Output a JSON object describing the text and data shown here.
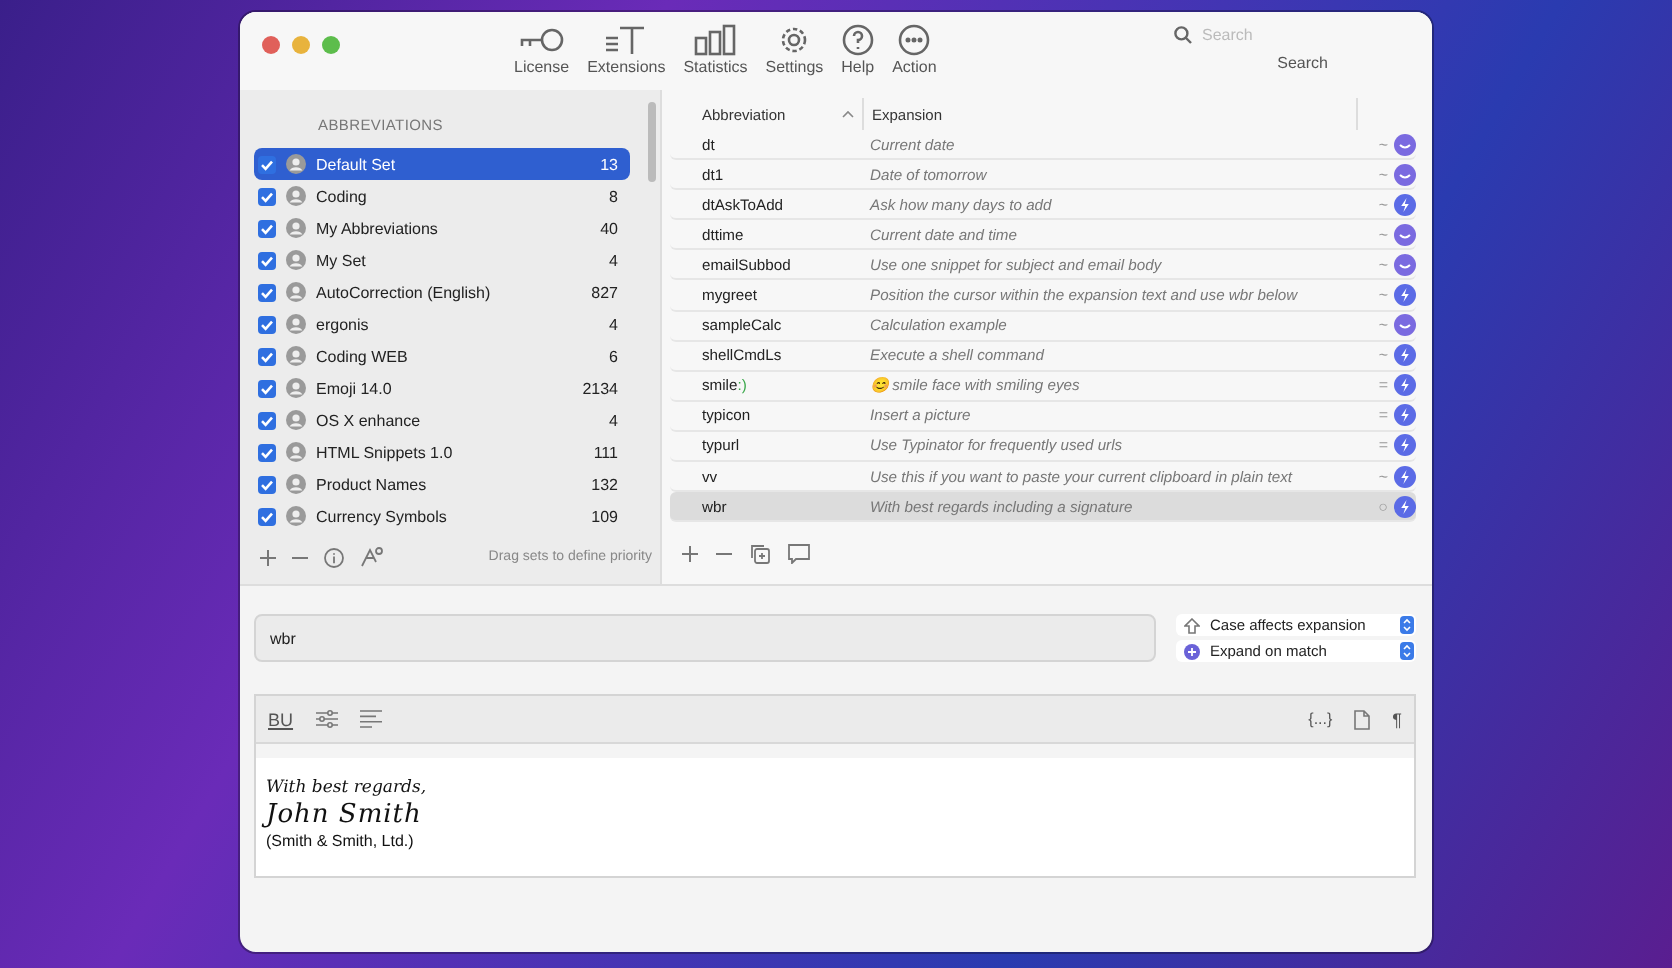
{
  "window": {
    "toolbar": [
      {
        "kind": "key",
        "label": "License"
      },
      {
        "kind": "ext",
        "label": "Extensions"
      },
      {
        "kind": "stats",
        "label": "Statistics"
      },
      {
        "kind": "gear",
        "label": "Settings"
      },
      {
        "kind": "help",
        "label": "Help"
      },
      {
        "kind": "more",
        "label": "Action"
      }
    ],
    "search": {
      "placeholder": "Search",
      "label": "Search"
    }
  },
  "sidebar": {
    "heading": "ABBREVIATIONS",
    "items": [
      {
        "name": "Default Set",
        "count": "13",
        "checked": true,
        "selected": true
      },
      {
        "name": "Coding",
        "count": "8",
        "checked": true,
        "selected": false
      },
      {
        "name": "My Abbreviations",
        "count": "40",
        "checked": true,
        "selected": false
      },
      {
        "name": "My Set",
        "count": "4",
        "checked": true,
        "selected": false
      },
      {
        "name": "AutoCorrection (English)",
        "count": "827",
        "checked": true,
        "selected": false
      },
      {
        "name": "ergonis",
        "count": "4",
        "checked": true,
        "selected": false
      },
      {
        "name": "Coding WEB",
        "count": "6",
        "checked": true,
        "selected": false
      },
      {
        "name": "Emoji 14.0",
        "count": "2134",
        "checked": true,
        "selected": false
      },
      {
        "name": "OS X enhance",
        "count": "4",
        "checked": true,
        "selected": false
      },
      {
        "name": "HTML Snippets 1.0",
        "count": "111",
        "checked": true,
        "selected": false
      },
      {
        "name": "Product Names",
        "count": "132",
        "checked": true,
        "selected": false
      },
      {
        "name": "Currency Symbols",
        "count": "109",
        "checked": true,
        "selected": false
      }
    ],
    "hint": "Drag sets to define priority"
  },
  "table": {
    "columns": [
      "Abbreviation",
      "Expansion"
    ],
    "rows": [
      {
        "abbreviation": "dt",
        "expansion": "Current date",
        "mode": "~",
        "kind": "text",
        "selected": false
      },
      {
        "abbreviation": "dt1",
        "expansion": "Date of tomorrow",
        "mode": "~",
        "kind": "text",
        "selected": false
      },
      {
        "abbreviation": "dtAskToAdd",
        "expansion": "Ask how many days to add",
        "mode": "~",
        "kind": "bolt",
        "selected": false
      },
      {
        "abbreviation": "dttime",
        "expansion": "Current date and time",
        "mode": "~",
        "kind": "text",
        "selected": false
      },
      {
        "abbreviation": "emailSubbod",
        "expansion": "Use one snippet for subject and email body",
        "mode": "~",
        "kind": "text",
        "selected": false
      },
      {
        "abbreviation": "mygreet",
        "expansion": "Position the cursor within the expansion text and use wbr below",
        "mode": "~",
        "kind": "bolt",
        "selected": false
      },
      {
        "abbreviation": "sampleCalc",
        "expansion": "Calculation example",
        "mode": "~",
        "kind": "text",
        "selected": false
      },
      {
        "abbreviation": "shellCmdLs",
        "expansion": "Execute a shell command",
        "mode": "~",
        "kind": "bolt",
        "selected": false
      },
      {
        "abbreviation": "smile",
        "suffix": ":)",
        "expansion": "😊 smile face with smiling eyes",
        "mode": "=",
        "kind": "bolt",
        "selected": false
      },
      {
        "abbreviation": "typicon",
        "expansion": "Insert a picture",
        "mode": "=",
        "kind": "bolt",
        "selected": false
      },
      {
        "abbreviation": "typurl",
        "expansion": "Use Typinator for frequently used urls",
        "mode": "=",
        "kind": "bolt",
        "selected": false
      },
      {
        "abbreviation": "vv",
        "expansion": "Use this if you want to paste your current clipboard in plain text",
        "mode": "~",
        "kind": "bolt",
        "selected": false
      },
      {
        "abbreviation": "wbr",
        "expansion": "With best regards including a signature",
        "mode": "○",
        "kind": "bolt",
        "selected": true
      }
    ]
  },
  "editor": {
    "abbreviation_value": "wbr",
    "options": [
      {
        "kind": "shift",
        "label": "Case affects expansion"
      },
      {
        "kind": "match",
        "label": "Expand on match"
      }
    ],
    "format_label": "BU",
    "variable_label": "{...}",
    "paragraph_label": "¶",
    "content": [
      {
        "kind": "greeting",
        "text": "With best regards,"
      },
      {
        "kind": "signature",
        "text": "John Smith"
      },
      {
        "kind": "plain",
        "text": "(Smith & Smith, Ltd.)"
      }
    ]
  }
}
